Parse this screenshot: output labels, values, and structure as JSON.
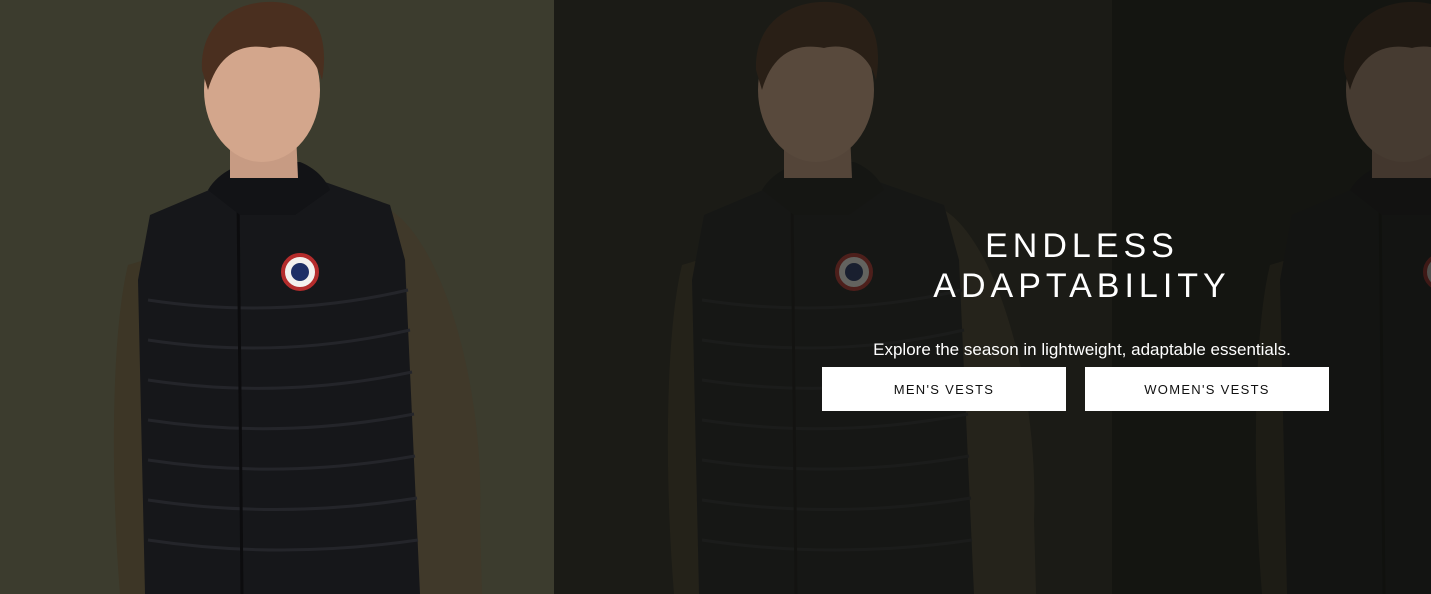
{
  "hero": {
    "headline": "ENDLESS ADAPTABILITY",
    "subheadline": "Explore the season in lightweight, adaptable essentials.",
    "buttons": {
      "mens_label": "MEN'S VESTS",
      "womens_label": "WOMEN'S VESTS"
    }
  },
  "colors": {
    "panel_left": "#3c3c2e",
    "panel_middle": "#21221b",
    "panel_right": "#191a15",
    "button_bg": "#ffffff",
    "button_text": "#111111",
    "text_light": "#ffffff"
  },
  "imagery": {
    "subject": "model-in-black-down-vest-over-olive-sweater",
    "badge_icon": "round-logo-patch-icon"
  }
}
